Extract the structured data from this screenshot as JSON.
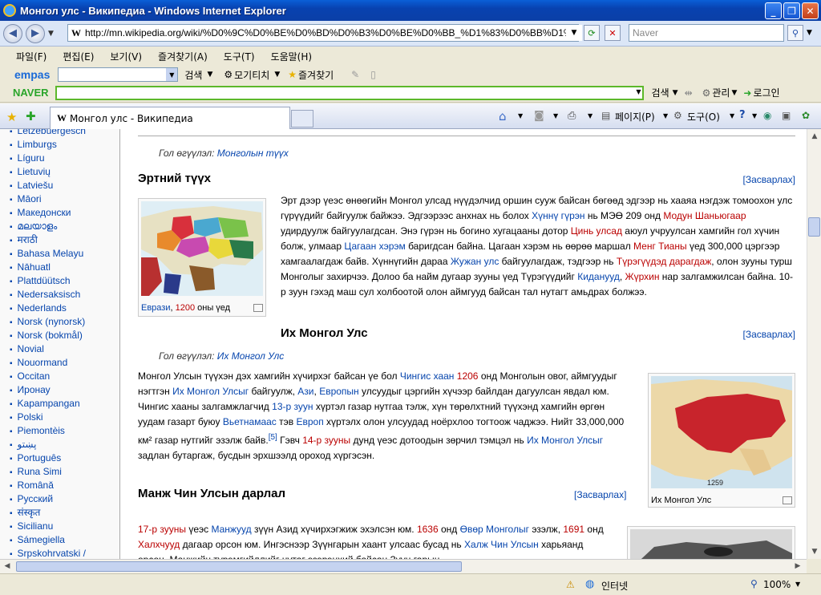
{
  "window": {
    "title": "Монгол улс - Википедиа - Windows Internet Explorer",
    "min": "_",
    "max": "❐",
    "close": "✕"
  },
  "address": {
    "url": "http://mn.wikipedia.org/wiki/%D0%9C%D0%BE%D0%BD%D0%B3%D0%BE%D0%BB_%D1%83%D0%BB%D1%",
    "search_placeholder": "Naver"
  },
  "menu": [
    "파일(F)",
    "편집(E)",
    "보기(V)",
    "즐겨찾기(A)",
    "도구(T)",
    "도움말(H)"
  ],
  "toolbar1": {
    "logo": "empas",
    "search": "검색",
    "mogi": "모기티치",
    "fav": "즐겨찾기"
  },
  "toolbar2": {
    "logo": "NAVER",
    "search": "검색",
    "manage": "관리",
    "login": "로그인"
  },
  "tab": {
    "title": "Монгол улс - Википедиа"
  },
  "cmdbar": {
    "page": "페이지(P)",
    "tools": "도구(O)"
  },
  "sidebar": [
    "Letzebuergesch",
    "Limburgs",
    "Líguru",
    "Lietuvių",
    "Latviešu",
    "Māori",
    "Македонски",
    "മലയാളം",
    "मराठी",
    "Bahasa Melayu",
    "Nāhuatl",
    "Plattdüütsch",
    "Nedersaksisch",
    "Nederlands",
    "Norsk (nynorsk)",
    "Norsk (bokmål)",
    "Novial",
    "Nouormand",
    "Occitan",
    "Иронау",
    "Kapampangan",
    "Polski",
    "Piemontèis",
    "پښتو",
    "Português",
    "Runa Simi",
    "Română",
    "Русский",
    "संस्कृत",
    "Sicilianu",
    "Sámegiella",
    "Srpskohrvatski /"
  ],
  "article": {
    "note1_prefix": "Гол өгүүлэл: ",
    "note1_link": "Монголын түүх",
    "s1_title": "Эртний түүх",
    "edit": "[Засварлах]",
    "s1_para": "Эрт дээр үеэс өнөөгийн Монгол улсад нүүдэлчид оршин сууж байсан бөгөөд эдгээр нь хааяа нэгдэж томоохон улс гүрүүдийг байгуулж байжээ. Эдгээрээс анхнах нь болох Хүннү гүрэн нь МЭӨ 209 онд Модун Шаньюгаар удирдуулж байгуулагдсан. Энэ гүрэн нь богино хугацааны дотор Цинь улсад аюул учруулсан хамгийн гол хүчин болж, улмаар Цагаан хэрэм баригдсан байна. Цагаан хэрэм нь өөрөө маршал Менг Тианы үед 300,000 цэргээр хамгаалагдаж байв. Хүннүгийн дараа Жужан улс байгуулагдаж, тэдгээр нь Түрэгүүдэд дарагдаж, олон зууны турш Монголыг захирчээ. Долоо ба найм дугаар зууны үед Түрэгүүдийг Киданууд, Жүрхин нар залгамжилсан байна. 10-р зуун гэхэд маш сул холбоотой олон аймгууд байсан тал нутагт амьдрах болжээ.",
    "cap1_a": "Еврази",
    "cap1_b": ", ",
    "cap1_c": "1200",
    "cap1_d": " оны үед",
    "s2_title": "Их Монгол Улс",
    "note2_prefix": "Гол өгүүлэл: ",
    "note2_link": "Их Монгол Улс",
    "s2_para": "Монгол Улсын түүхэн дэх хамгийн хүчирхэг байсан үе бол Чингис хаан 1206 онд Монголын овог, аймгуудыг нэгтгэн Их Монгол Улсыг байгуулж, Ази, Европын улсуудыг цэргийн хүчээр байлдан дагуулсан явдал юм. Чингис хааны залгамжлагчид 13-р зуун хүртэл газар нутгаа тэлж, хүн төрөлхтний түүхэнд хамгийн өргөн уудам газарт буюу Вьетнамаас тэв Европ хүртэлх олон улсуудад ноёрхлоо тогтоож чаджээ. Нийт 33,000,000 км² газар нутгийг эзэлж байв.[5] Гэвч 14-р зууны дунд үеэс дотоодын зөрчил тэмцэл нь Их Монгол Улсыг задлан бутаргаж, бусдын эрхшээлд ороход хүргэсэн.",
    "cap2": "Их Монгол Улс",
    "map2_year": "1259",
    "s3_title": "Манж Чин Улсын дарлал",
    "s3_para": "17-р зууны үеэс Манжууд зүүн Азид хүчирхэгжиж эхэлсэн юм. 1636 онд Өвөр Монголыг эзэлж, 1691 онд Халхчууд дагаар орсон юм. Ингэснээр Зүүнгарын хаант улсаас бусад нь Халж Чин Улсын харьяанд орсон. Манжийн түрэмгийллийг нутаг эзэрэнхий байсан Зүүн гарын"
  },
  "status": {
    "zone": "인터넷",
    "zoom": "100%"
  }
}
